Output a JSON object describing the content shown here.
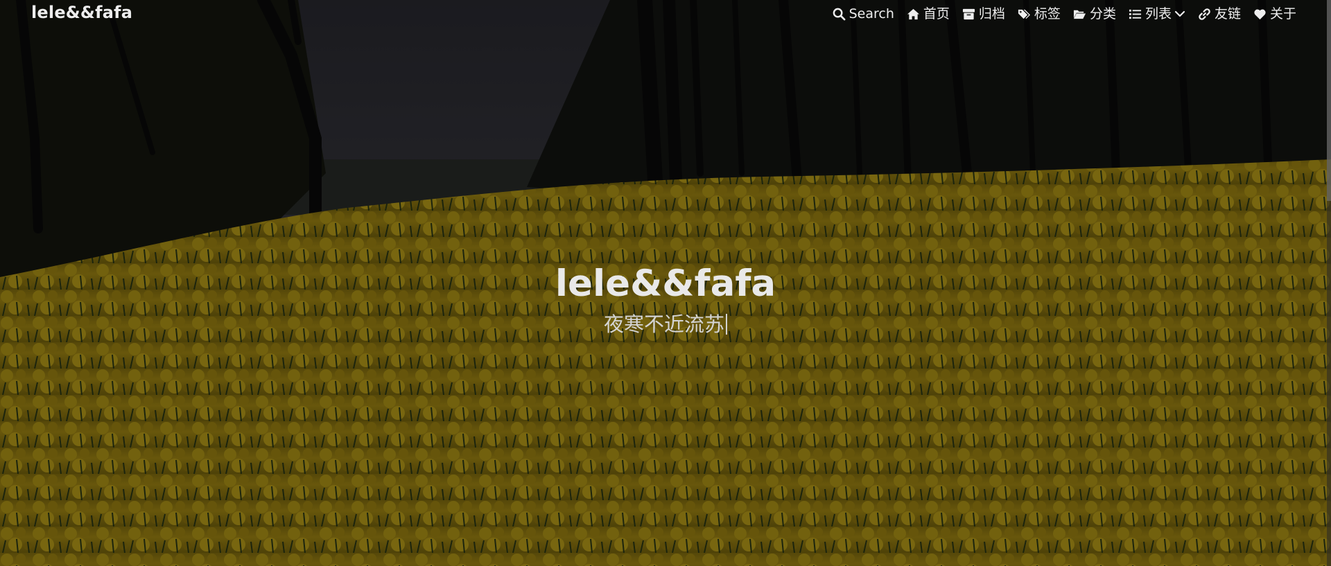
{
  "site": {
    "brand": "lele&&fafa"
  },
  "nav": {
    "items": [
      {
        "label": "Search",
        "icon": "search-icon"
      },
      {
        "label": "首页",
        "icon": "home-icon"
      },
      {
        "label": "归档",
        "icon": "archive-icon"
      },
      {
        "label": "标签",
        "icon": "tags-icon"
      },
      {
        "label": "分类",
        "icon": "folder-open-icon"
      },
      {
        "label": "列表",
        "icon": "list-icon",
        "dropdown": true
      },
      {
        "label": "友链",
        "icon": "link-icon"
      },
      {
        "label": "关于",
        "icon": "heart-icon"
      }
    ]
  },
  "hero": {
    "title": "lele&&fafa",
    "subtitle": "夜寒不近流苏"
  },
  "colors": {
    "flowers": "#b59a12",
    "sky": "#3a3a44",
    "overlay": "#000000"
  }
}
